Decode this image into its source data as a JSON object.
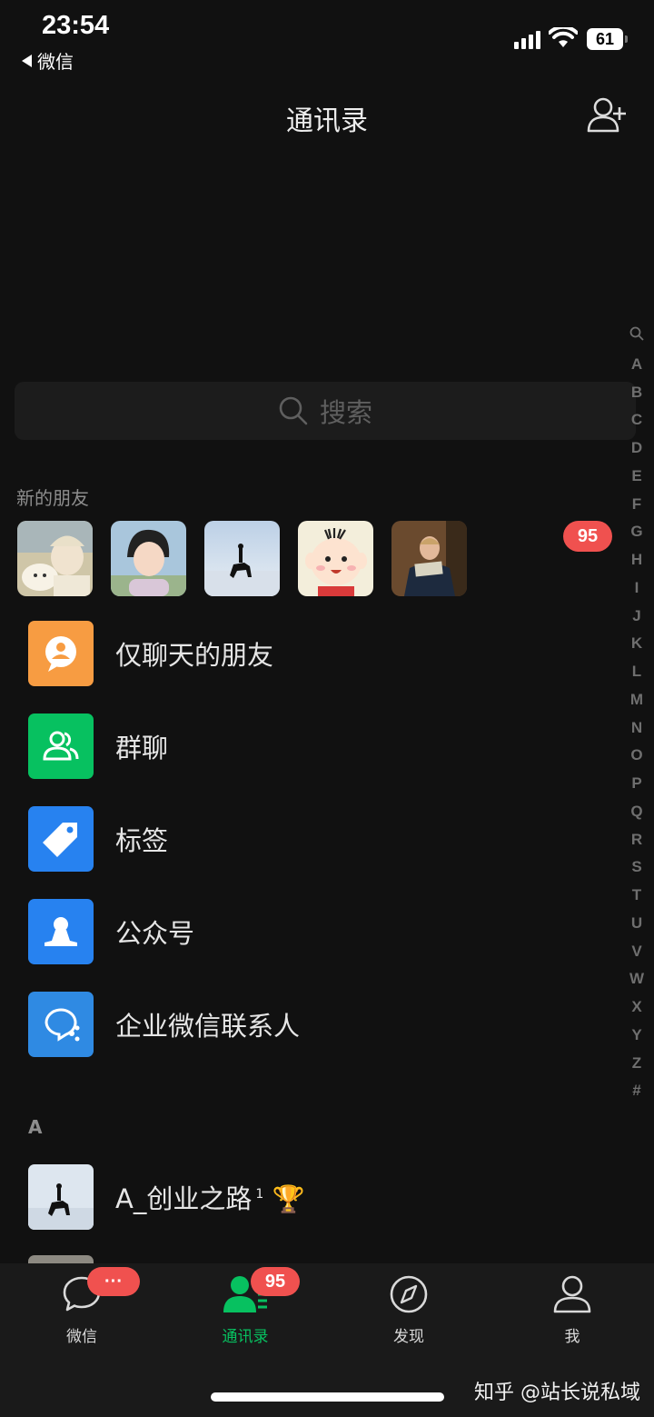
{
  "status_bar": {
    "time": "23:54",
    "back_app": "微信",
    "battery": "61"
  },
  "header": {
    "title": "通讯录"
  },
  "search": {
    "placeholder": "搜索"
  },
  "index_bar": [
    "Q",
    "A",
    "B",
    "C",
    "D",
    "E",
    "F",
    "G",
    "H",
    "I",
    "J",
    "K",
    "L",
    "M",
    "N",
    "O",
    "P",
    "Q",
    "R",
    "S",
    "T",
    "U",
    "V",
    "W",
    "X",
    "Y",
    "Z",
    "#"
  ],
  "new_friends": {
    "label": "新的朋友",
    "badge": "95"
  },
  "menu": [
    {
      "label": "仅聊天的朋友",
      "icon": "chat-only-friend-icon",
      "color": "#f79c42"
    },
    {
      "label": "群聊",
      "icon": "group-chat-icon",
      "color": "#07c160"
    },
    {
      "label": "标签",
      "icon": "tag-icon",
      "color": "#2782f0"
    },
    {
      "label": "公众号",
      "icon": "official-account-icon",
      "color": "#2782f0"
    },
    {
      "label": "企业微信联系人",
      "icon": "wecom-contacts-icon",
      "color": "#2f8ae3"
    }
  ],
  "contacts": {
    "section": "A",
    "items": [
      {
        "name": "A_创业之路",
        "sup": "1",
        "emoji": "🏆"
      }
    ]
  },
  "tabbar": [
    {
      "label": "微信",
      "badge": "···"
    },
    {
      "label": "通讯录",
      "badge": "95"
    },
    {
      "label": "发现"
    },
    {
      "label": "我"
    }
  ],
  "watermark": "知乎 @站长说私域",
  "colors": {
    "accent": "#07c160",
    "badge": "#f0514f"
  }
}
